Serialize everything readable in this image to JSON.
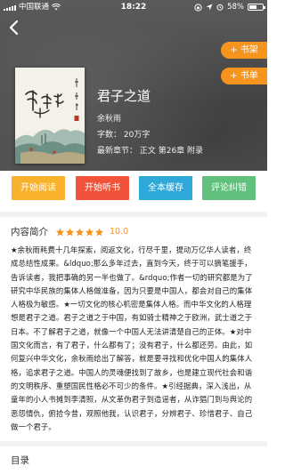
{
  "status_bar": {
    "carrier": "中国联通",
    "time": "18:22",
    "battery": "58%",
    "battery_level": 0.58
  },
  "header": {
    "add_to_shelf": "+ 书架",
    "add_to_list": "+ 书单"
  },
  "book": {
    "title": "君子之道",
    "author": "余秋雨",
    "word_count": "字数：  20万字",
    "latest_chapter": "最新章节：  正文 第26章 附录",
    "cover_title": "君子之道",
    "cover_author": "余秋雨"
  },
  "actions": {
    "read": "开始阅读",
    "listen": "开始听书",
    "cache": "全本缓存",
    "report": "评论纠错"
  },
  "intro": {
    "label": "内容简介",
    "score": "10.0",
    "star_count": 5,
    "text": "★余秋雨耗费十几年探索，阅返文化，行尽千里，提动万亿华人读者，终成总结性成果。&ldquo;那么多年过去，直到今天，终于可以摘笔援手，告诉读者，我把事确的另一半也做了。&rdquo;作者一切的研究都是为了研究中华民族的集体人格做准备，因为只要是中国人，都会对自己的集体人格极为敏感。★一切文化的核心机密是集体人格。而中华文化的人格理想是君子之道。君子之道之于中国，有如骑士精神之于欧洲，武士道之于日本。不了解君子之道，就像一个中国人无法讲清楚自己的正体。★对中国文化而言，有了君子，什么都有了；没有君子，什么都还劳。由此，如何复兴中华文化，余秋雨给出了解答，就是要寻找和优化中国人的集体人格，追求君子之道。中国人的灵魂便找到了故乡，也是建立现代社会和谐的文明秩序、重塑国民性格必不可少的条件。★引经据典，深入浅出，从童年的小人书摊到李清照，从文革伪君子到造谣者，从诈猖门到与舆论的恶怨情仇，俯拾今昔，观照他我，认识君子，分辨君子、珍惜君子、自己做一个君子。"
  },
  "toc": {
    "label": "目录"
  },
  "colors": {
    "accent_orange": "#f7941d",
    "btn_read": "#f7b12b",
    "btn_listen": "#f0533a",
    "btn_cache": "#2ea8d8",
    "btn_report": "#61c07c"
  }
}
